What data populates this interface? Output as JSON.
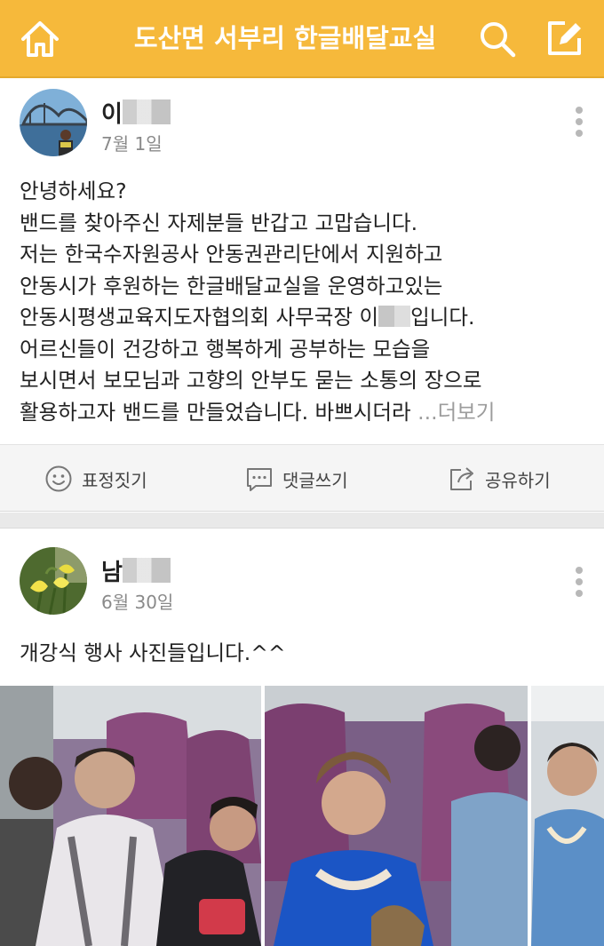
{
  "app": {
    "title": "도산면 서부리 한글배달교실",
    "colors": {
      "header": "#f6b93b",
      "header_text": "#ffffff",
      "muted": "#8a8a8a"
    },
    "icons": {
      "home": "home-icon",
      "search": "search-icon",
      "write": "write-icon"
    }
  },
  "post1": {
    "author_prefix": "이",
    "date": "7월 1일",
    "lines": [
      "안녕하세요?",
      "밴드를  찾아주신 자제분들 반갑고 고맙습니다.",
      "저는 한국수자원공사 안동권관리단에서 지원하고",
      "안동시가 후원하는 한글배달교실을 운영하고있는"
    ],
    "line5_before": "안동시평생교육지도자협의회 사무국장 이",
    "line5_after": "입니다.",
    "lines_after": [
      "어르신들이 건강하고 행복하게 공부하는 모습을",
      "보시면서 보모님과 고향의 안부도 묻는 소통의 장으로"
    ],
    "last_line": "활용하고자 밴드를 만들었습니다. 바쁘시더라",
    "ellipsis": " ...",
    "more_label": "더보기"
  },
  "actions": {
    "emote": "표정짓기",
    "comment": "댓글쓰기",
    "share": "공유하기"
  },
  "post2": {
    "author_prefix": "남",
    "date": "6월 30일",
    "text": "개강식 행사 사진들입니다.^^"
  }
}
